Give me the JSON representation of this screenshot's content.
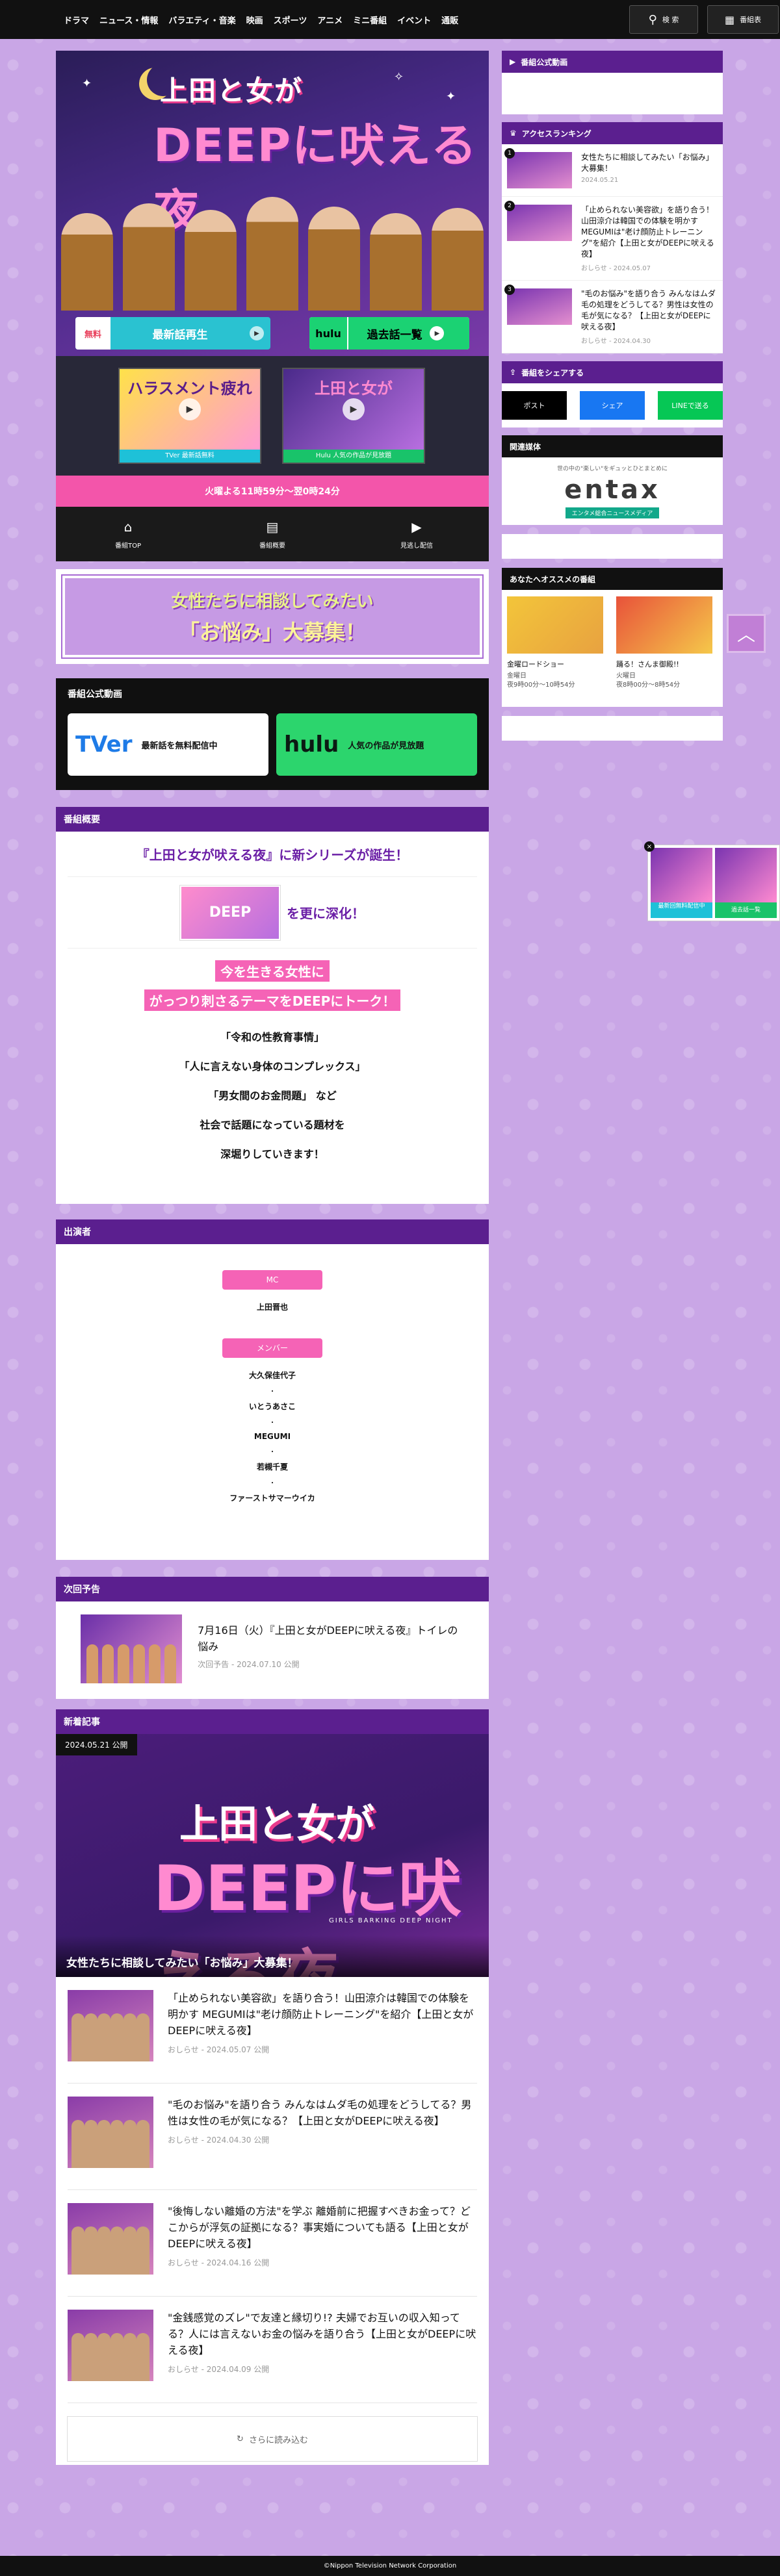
{
  "nav": {
    "items": [
      "ドラマ",
      "ニュース・情報",
      "バラエティ・音楽",
      "映画",
      "スポーツ",
      "アニメ",
      "ミニ番組",
      "イベント",
      "通販"
    ],
    "search_label": "検 索",
    "list_label": "番組表"
  },
  "hero": {
    "logo_top": "上田と女が",
    "logo_bottom": "DEEPに吠える夜",
    "new_tag": "無料",
    "new_label": "最新話再生",
    "old_tag": "hulu",
    "old_label": "過去話一覧"
  },
  "videos": [
    {
      "title": "ハラスメント疲れ",
      "caption": "TVer 最新話無料"
    },
    {
      "title": "上田と女が",
      "caption": "Hulu 人気の作品が見放題"
    }
  ],
  "airtime": "火曜よる11時59分～翌0時24分",
  "subnav": [
    {
      "icon": "⌂",
      "label": "番組TOP"
    },
    {
      "icon": "▤",
      "label": "番組概要"
    },
    {
      "icon": "▶",
      "label": "見逃し配信"
    }
  ],
  "banner": {
    "line1": "女性たちに相談してみたい",
    "line2": "「お悩み」大募集！"
  },
  "official_videos": {
    "heading": "番組公式動画",
    "tver_logo": "TVer",
    "tver_text": "最新話を無料配信中",
    "hulu_logo": "hulu",
    "hulu_text": "人気の作品が見放題"
  },
  "summary": {
    "heading": "番組概要",
    "s1": "『上田と女が吠える夜』に新シリーズが誕生！",
    "s2_thumb": "DEEP",
    "s2": "を更に深化！",
    "hl1": "今を生きる女性に",
    "hl2": "がっつり刺さるテーマをDEEPにトーク！",
    "lines": [
      "「令和の性教育事情」",
      "「人に言えない身体のコンプレックス」",
      "「男女間のお金問題」 など",
      "社会で話題になっている題材を",
      "深堀りしていきます！"
    ]
  },
  "cast": {
    "heading": "出演者",
    "mc_label": "MC",
    "mc": "上田晋也",
    "member_label": "メンバー",
    "members": [
      "大久保佳代子",
      "いとうあさこ",
      "MEGUMI",
      "若槻千夏",
      "ファーストサマーウイカ"
    ],
    "separator": "・"
  },
  "next": {
    "heading": "次回予告",
    "title": "7月16日（火）『上田と女がDEEPに吠える夜』トイレの悩み",
    "date": "次回予告 - 2024.07.10 公開"
  },
  "news": {
    "heading": "新着記事",
    "feat_date": "2024.05.21 公開",
    "feat_logo_top": "上田と女が",
    "feat_logo_bottom": "DEEPに吠える夜",
    "feat_sub": "GIRLS BARKING DEEP NIGHT",
    "feat_caption": "女性たちに相談してみたい「お悩み」大募集！",
    "items": [
      {
        "title": "「止められない美容欲」を語り合う！山田涼介は韓国での体験を明かす MEGUMIは\"老け顔防止トレーニング\"を紹介【上田と女がDEEPに吠える夜】",
        "date": "おしらせ - 2024.05.07 公開"
      },
      {
        "title": "\"毛のお悩み\"を語り合う みんなはムダ毛の処理をどうしてる？男性は女性の毛が気になる？【上田と女がDEEPに吠える夜】",
        "date": "おしらせ - 2024.04.30 公開"
      },
      {
        "title": "\"後悔しない離婚の方法\"を学ぶ 離婚前に把握すべきお金って？どこからが浮気の証拠になる？事実婚についても語る【上田と女がDEEPに吠える夜】",
        "date": "おしらせ - 2024.04.16 公開"
      },
      {
        "title": "\"金銭感覚のズレ\"で友達と縁切り!? 夫婦でお互いの収入知ってる？人には言えないお金の悩みを語り合う【上田と女がDEEPに吠える夜】",
        "date": "おしらせ - 2024.04.09 公開"
      }
    ],
    "more": "さらに読み込む"
  },
  "sidebar": {
    "official_heading": "番組公式動画",
    "ranking_heading": "アクセスランキング",
    "ranking": [
      {
        "num": "1",
        "title": "女性たちに相談してみたい「お悩み」大募集！",
        "date": "2024.05.21"
      },
      {
        "num": "2",
        "title": "「止められない美容欲」を語り合う！山田涼介は韓国での体験を明かす MEGUMIは\"老け顔防止トレーニング\"を紹介【上田と女がDEEPに吠える夜】",
        "date": "おしらせ - 2024.05.07"
      },
      {
        "num": "3",
        "title": "\"毛のお悩み\"を語り合う みんなはムダ毛の処理をどうしてる？男性は女性の毛が気になる？【上田と女がDEEPに吠える夜】",
        "date": "おしらせ - 2024.04.30"
      }
    ],
    "share_heading": "番組をシェアする",
    "share": [
      {
        "label": "ポスト",
        "color": "#000000"
      },
      {
        "label": "シェア",
        "color": "#1877f2"
      },
      {
        "label": "LINEで送る",
        "color": "#06c755"
      }
    ],
    "media_heading": "関連媒体",
    "media_tagline": "世の中の\"楽しい\"をギュッとひとまとめに",
    "media_logo": "entax",
    "media_caption": "エンタメ総合ニュースメディア",
    "rec_heading": "あなたへオススメの番組",
    "rec": [
      {
        "title": "金曜ロードショー",
        "d1": "金曜日",
        "d2": "夜9時00分～10時54分"
      },
      {
        "title": "踊る！さんま御殿!!",
        "d1": "火曜日",
        "d2": "夜8時00分～8時54分"
      }
    ]
  },
  "popup": {
    "left": "最新回無料配信中",
    "right": "過去話一覧",
    "close": "×"
  },
  "footer": "©Nippon Television Network Corporation"
}
